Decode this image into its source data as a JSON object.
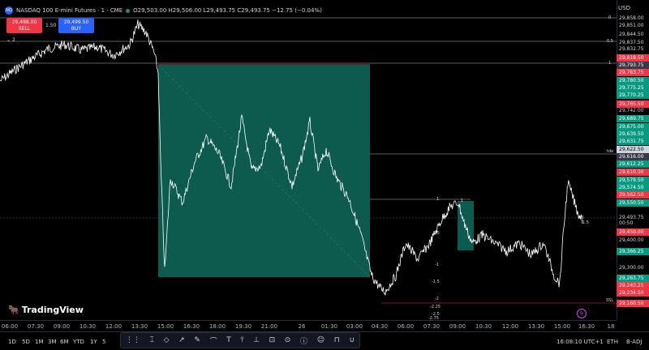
{
  "header": {
    "symbol_badge": "NQ",
    "title": "NASDAQ 100 E-mini Futures · 1 · CME",
    "ohlc": "O29,503.00 H29,506.00 L29,493.75 C29,493.75 −12.75 (−0.04%)"
  },
  "trade": {
    "sell_price": "29,498.00",
    "sell_label": "SELL",
    "buy_price": "29,499.50",
    "buy_label": "BUY",
    "spread": "1.50"
  },
  "indicators_toggle": "2",
  "currency": "USD",
  "price_labels": [
    {
      "text": "29,858.00",
      "style": "plain"
    },
    {
      "text": "29,851.00",
      "style": "plain"
    },
    {
      "text": "29,844.50",
      "style": "plain"
    },
    {
      "text": "29,837.50",
      "style": "plain"
    },
    {
      "text": "29,832.75",
      "style": "plain"
    },
    {
      "text": "29,818.50",
      "style": "red"
    },
    {
      "text": "29,793.75",
      "style": "grey"
    },
    {
      "text": "29,783.75",
      "style": "red"
    },
    {
      "text": "29,780.50",
      "style": "green"
    },
    {
      "text": "29,775.25",
      "style": "green"
    },
    {
      "text": "29,770.25",
      "style": "green"
    },
    {
      "text": "29,765.50",
      "style": "red"
    },
    {
      "text": "29,742.00",
      "style": "plain"
    },
    {
      "text": "29,689.75",
      "style": "green"
    },
    {
      "text": "29,675.00",
      "style": "green"
    },
    {
      "text": "29,639.50",
      "style": "green"
    },
    {
      "text": "29,631.75",
      "style": "green"
    },
    {
      "text": "29,622.50",
      "style": "white"
    },
    {
      "text": "29,616.00",
      "style": "grey"
    },
    {
      "text": "29,612.25",
      "style": "green"
    },
    {
      "text": "29,610.00",
      "style": "red"
    },
    {
      "text": "29,579.50",
      "style": "green"
    },
    {
      "text": "29,574.50",
      "style": "green"
    },
    {
      "text": "29,562.50",
      "style": "red"
    },
    {
      "text": "29,550.50",
      "style": "green"
    },
    {
      "text": "29,493.75",
      "style": "plain"
    },
    {
      "text": "00:50",
      "style": "plain"
    },
    {
      "text": "29,450.00",
      "style": "red"
    },
    {
      "text": "29,400.00",
      "style": "plain"
    },
    {
      "text": "29,366.25",
      "style": "green"
    },
    {
      "text": "29,300.00",
      "style": "plain"
    },
    {
      "text": "29,263.75",
      "style": "green"
    },
    {
      "text": "29,243.25",
      "style": "red"
    },
    {
      "text": "29,234.50",
      "style": "red"
    },
    {
      "text": "29,160.50",
      "style": "red"
    }
  ],
  "time_labels": [
    "06:00",
    "07:30",
    "09:00",
    "10:30",
    "12:00",
    "13:30",
    "15:00",
    "16:30",
    "18:00",
    "19:30",
    "21:00",
    "26",
    "01:30",
    "03:00",
    "04:30",
    "06:00",
    "07:30",
    "09:00",
    "10:30",
    "12:00",
    "13:30",
    "15:00",
    "16:30",
    "18"
  ],
  "fib_labels": [
    "0",
    "0.5",
    "1",
    "tde",
    "1",
    "0.5",
    "-1",
    "-1.5",
    "-2",
    "-2.25",
    "-2.5",
    "-2.75",
    "SSL",
    "1",
    "0.5",
    "1.5"
  ],
  "timeframes": [
    "1D",
    "5D",
    "1M",
    "3M",
    "6M",
    "YTD",
    "1Y",
    "5"
  ],
  "status": {
    "clock": "16:08:10 UTC+1",
    "session": "ETH",
    "adjust": "B-ADJ"
  },
  "brand": "TradingView",
  "scale_auto": "A",
  "scale_log": "L",
  "toolbar_icons": [
    "cursor-icon",
    "eraser-icon",
    "trendline-icon",
    "pencil-icon",
    "brush-icon",
    "text-icon",
    "vertical-line-icon",
    "horizontal-line-icon",
    "measure-icon",
    "target-icon",
    "info-icon",
    "emoji-icon",
    "lock-icon",
    "magnet-icon"
  ],
  "colors": {
    "bull": "#089981",
    "bear": "#f23645",
    "accent": "#2962ff",
    "zone": "#0d5a4f"
  }
}
